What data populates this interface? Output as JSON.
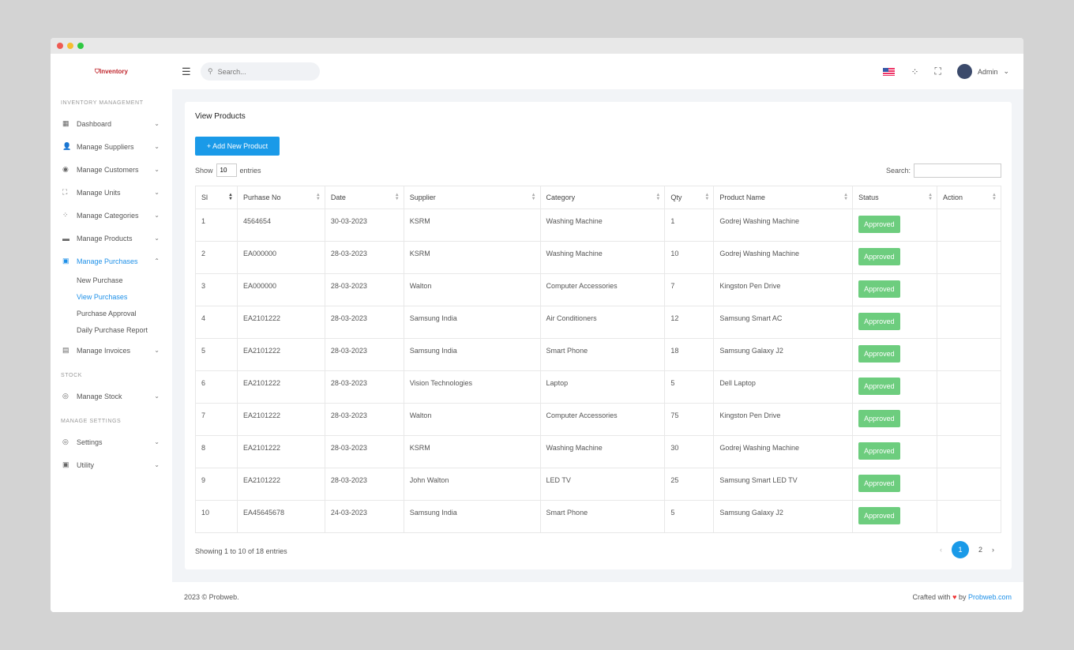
{
  "app": {
    "logo": "Inventory",
    "search_placeholder": "Search...",
    "user": "Admin"
  },
  "sidebar": {
    "section1": "INVENTORY MANAGEMENT",
    "section2": "STOCK",
    "section3": "MANAGE SETTINGS",
    "items": [
      {
        "label": "Dashboard",
        "icon": "▦"
      },
      {
        "label": "Manage Suppliers",
        "icon": "👤"
      },
      {
        "label": "Manage Customers",
        "icon": "◉"
      },
      {
        "label": "Manage Units",
        "icon": "⛶"
      },
      {
        "label": "Manage Categories",
        "icon": "⁘"
      },
      {
        "label": "Manage Products",
        "icon": "▬"
      },
      {
        "label": "Manage Purchases",
        "icon": "▣"
      },
      {
        "label": "Manage Invoices",
        "icon": "▤"
      }
    ],
    "submenu": [
      "New Purchase",
      "View Purchases",
      "Purchase Approval",
      "Daily Purchase Report"
    ],
    "stock": {
      "label": "Manage Stock",
      "icon": "◎"
    },
    "settings": [
      {
        "label": "Settings",
        "icon": "◎"
      },
      {
        "label": "Utility",
        "icon": "▣"
      }
    ]
  },
  "page": {
    "title": "View Products",
    "add_button": "+   Add New Product",
    "show": "Show",
    "entries_value": "10",
    "entries": "entries",
    "search_label": "Search:",
    "columns": [
      "Sl",
      "Purhase No",
      "Date",
      "Supplier",
      "Category",
      "Qty",
      "Product Name",
      "Status",
      "Action"
    ],
    "rows": [
      [
        "1",
        "4564654",
        "30-03-2023",
        "KSRM",
        "Washing Machine",
        "1",
        "Godrej Washing Machine",
        "Approved"
      ],
      [
        "2",
        "EA000000",
        "28-03-2023",
        "KSRM",
        "Washing Machine",
        "10",
        "Godrej Washing Machine",
        "Approved"
      ],
      [
        "3",
        "EA000000",
        "28-03-2023",
        "Walton",
        "Computer Accessories",
        "7",
        "Kingston Pen Drive",
        "Approved"
      ],
      [
        "4",
        "EA2101222",
        "28-03-2023",
        "Samsung India",
        "Air Conditioners",
        "12",
        "Samsung Smart AC",
        "Approved"
      ],
      [
        "5",
        "EA2101222",
        "28-03-2023",
        "Samsung India",
        "Smart Phone",
        "18",
        "Samsung Galaxy J2",
        "Approved"
      ],
      [
        "6",
        "EA2101222",
        "28-03-2023",
        "Vision Technologies",
        "Laptop",
        "5",
        "Dell Laptop",
        "Approved"
      ],
      [
        "7",
        "EA2101222",
        "28-03-2023",
        "Walton",
        "Computer Accessories",
        "75",
        "Kingston Pen Drive",
        "Approved"
      ],
      [
        "8",
        "EA2101222",
        "28-03-2023",
        "KSRM",
        "Washing Machine",
        "30",
        "Godrej Washing Machine",
        "Approved"
      ],
      [
        "9",
        "EA2101222",
        "28-03-2023",
        "John Walton",
        "LED TV",
        "25",
        "Samsung Smart LED TV",
        "Approved"
      ],
      [
        "10",
        "EA45645678",
        "24-03-2023",
        "Samsung India",
        "Smart Phone",
        "5",
        "Samsung Galaxy J2",
        "Approved"
      ]
    ],
    "info": "Showing 1 to 10 of 18 entries",
    "pages": [
      "‹",
      "1",
      "2",
      "›"
    ]
  },
  "footer": {
    "left": "2023 © Probweb.",
    "crafted": "Crafted with",
    "heart": "♥",
    "by": "by",
    "link": "Probweb.com"
  }
}
